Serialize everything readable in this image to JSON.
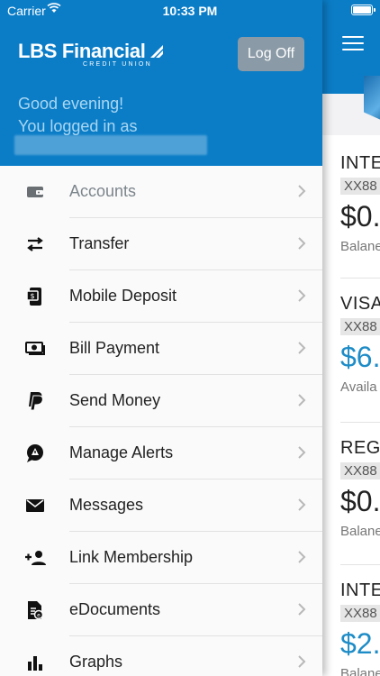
{
  "status": {
    "carrier": "Carrier",
    "time": "10:33 PM"
  },
  "drawer": {
    "brand_main": "LBS Financial",
    "brand_sub": "CREDIT UNION",
    "logoff_label": "Log Off",
    "greeting_line1": "Good evening!",
    "greeting_line2": "You logged in as",
    "menu": [
      {
        "label": "Accounts",
        "icon": "wallet-icon",
        "dimmed": true
      },
      {
        "label": "Transfer",
        "icon": "transfer-arrows-icon"
      },
      {
        "label": "Mobile Deposit",
        "icon": "mobile-deposit-icon"
      },
      {
        "label": "Bill Payment",
        "icon": "bill-payment-icon"
      },
      {
        "label": "Send Money",
        "icon": "paypal-icon"
      },
      {
        "label": "Manage Alerts",
        "icon": "alert-bubble-icon"
      },
      {
        "label": "Messages",
        "icon": "envelope-icon"
      },
      {
        "label": "Link Membership",
        "icon": "add-person-icon"
      },
      {
        "label": "eDocuments",
        "icon": "edocuments-icon"
      },
      {
        "label": "Graphs",
        "icon": "bar-chart-icon"
      }
    ]
  },
  "background": {
    "accounts": [
      {
        "name": "INTE",
        "number": "XX88",
        "amount": "$0.",
        "amount_color": "#222222",
        "label": "Balane"
      },
      {
        "name": "VISA",
        "number": "XX88",
        "amount": "$6.",
        "amount_color": "#1e8cc7",
        "label": "Availa"
      },
      {
        "name": "REGU",
        "number": "XX88",
        "amount": "$0.",
        "amount_color": "#222222",
        "label": "Balane"
      },
      {
        "name": "INTE",
        "number": "XX88",
        "amount": "$2.",
        "amount_color": "#1e8cc7",
        "label": "Balane"
      }
    ]
  },
  "colors": {
    "brand_blue": "#0b7dc7",
    "logoff_gray": "#8a9aa6",
    "amount_blue": "#1e8cc7"
  }
}
